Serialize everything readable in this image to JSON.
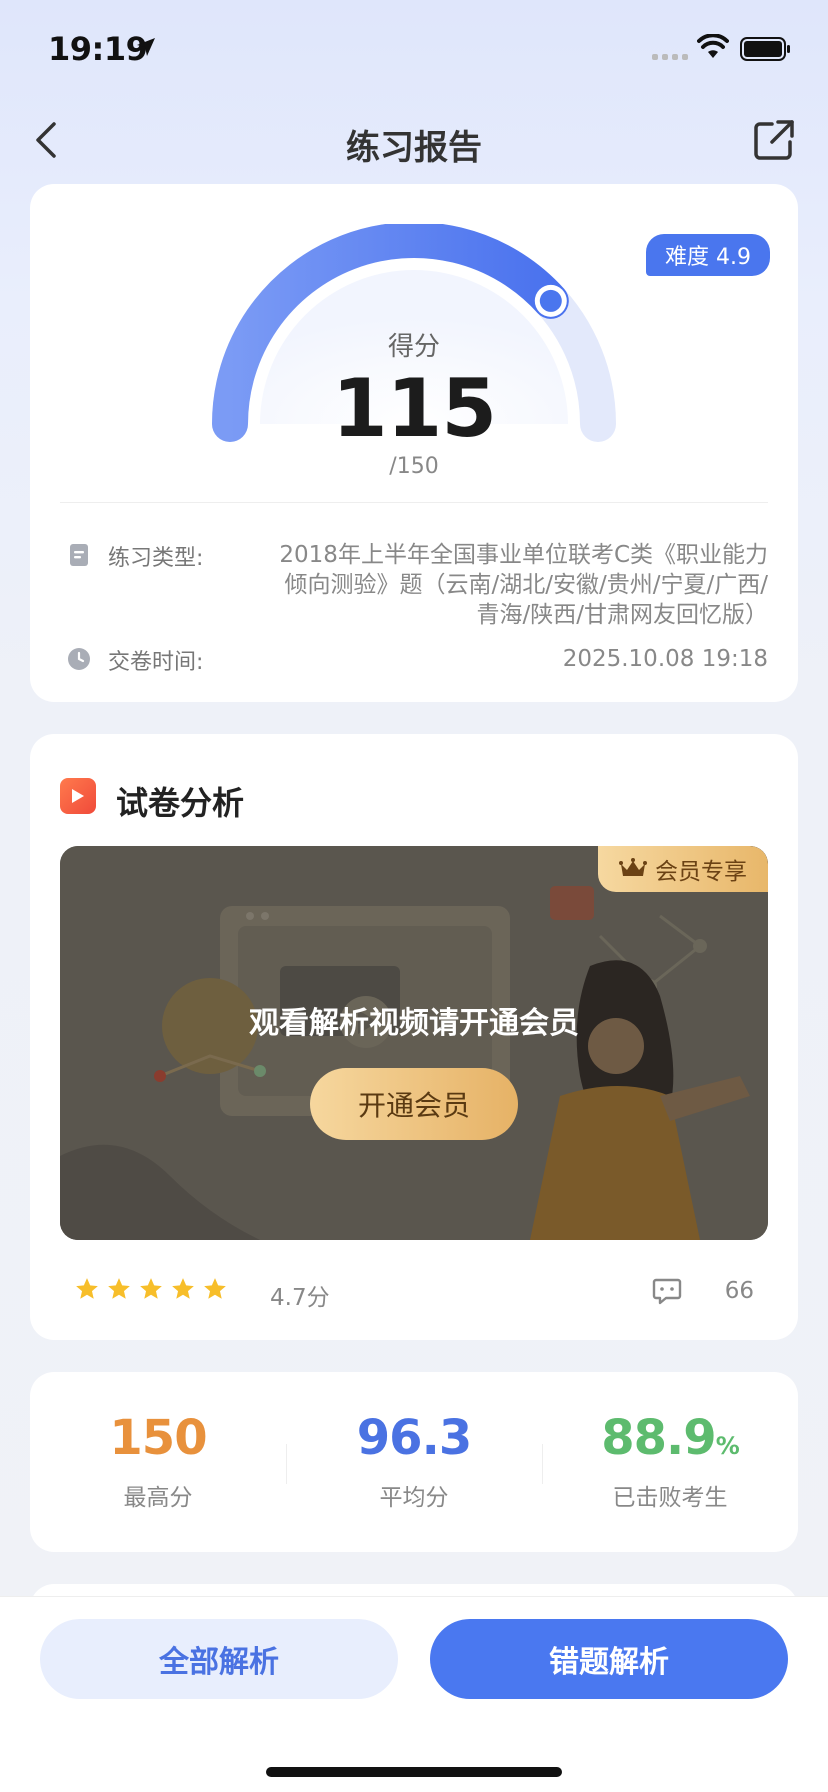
{
  "status_bar": {
    "time": "19:19"
  },
  "nav": {
    "title": "练习报告"
  },
  "score_card": {
    "difficulty": "难度 4.9",
    "score_label": "得分",
    "score": "115",
    "total": "/150",
    "score_fraction": 0.7667,
    "practice_type_label": "练习类型:",
    "practice_type_value": "2018年上半年全国事业单位联考C类《职业能力倾向测验》题（云南/湖北/安徽/贵州/宁夏/广西/青海/陕西/甘肃网友回忆版）",
    "submit_time_label": "交卷时间:",
    "submit_time_value": "2025.10.08 19:18"
  },
  "analysis": {
    "title": "试卷分析",
    "vip_tag": "会员专享",
    "video_prompt": "观看解析视频请开通会员",
    "open_vip_button": "开通会员",
    "rating": "4.7分",
    "rating_stars": 5,
    "comment_count": "66"
  },
  "stats": {
    "max_value": "150",
    "max_label": "最高分",
    "avg_value": "96.3",
    "avg_label": "平均分",
    "beat_value": "88.9",
    "beat_unit": "%",
    "beat_label": "已击败考生"
  },
  "bottom": {
    "all_button": "全部解析",
    "wrong_button": "错题解析"
  },
  "colors": {
    "accent_blue": "#4a76ee",
    "max_orange": "#e8913c",
    "avg_blue": "#4a72e2",
    "beat_green": "#5dbb6e",
    "vip_gold": "#e8b76a"
  }
}
